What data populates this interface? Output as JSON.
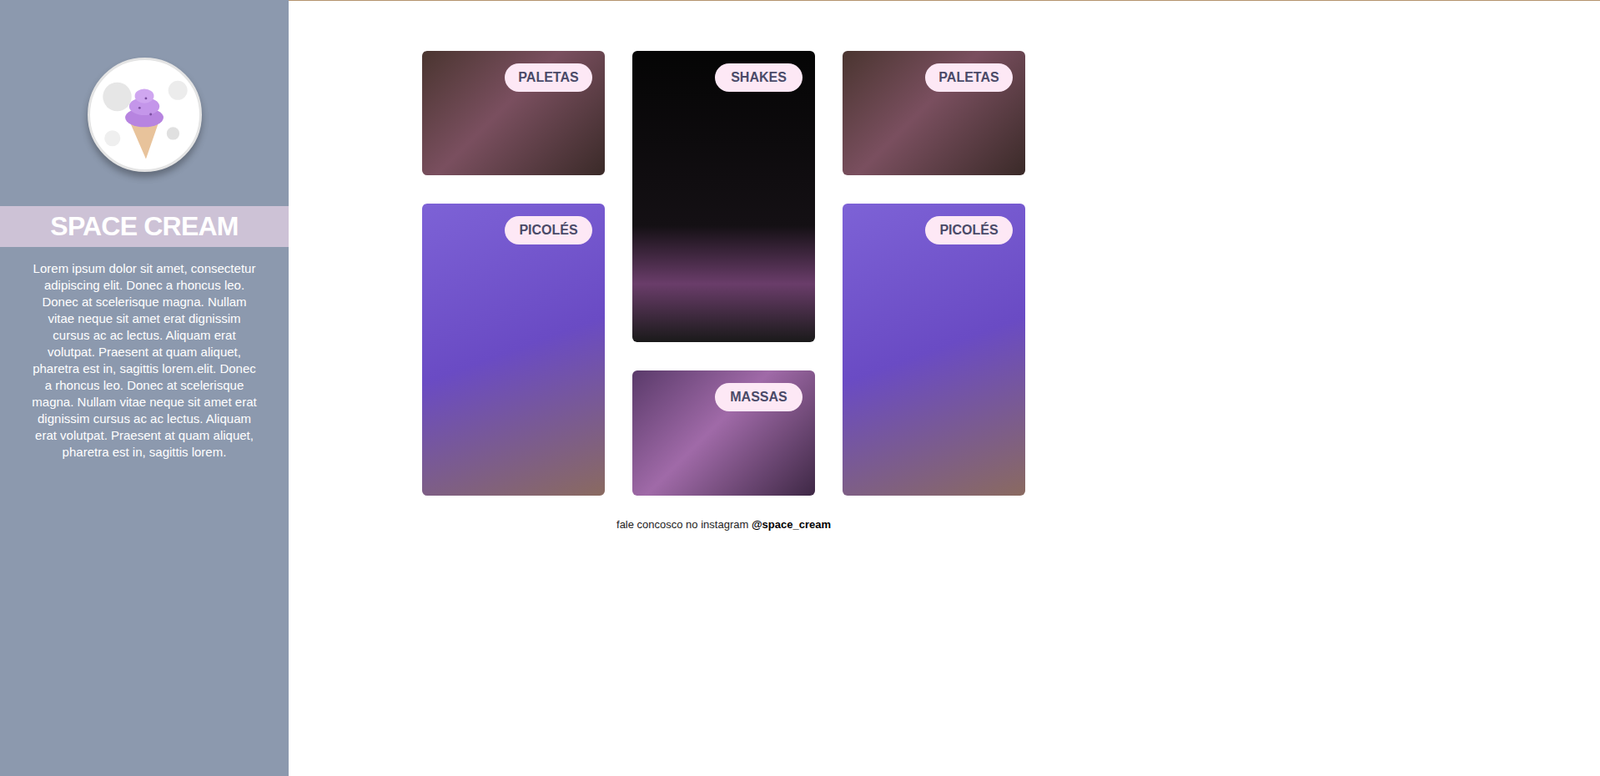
{
  "sidebar": {
    "title": "SPACE CREAM",
    "description": "Lorem ipsum dolor sit amet, consectetur adipiscing elit. Donec a rhoncus leo. Donec at scelerisque magna. Nullam vitae neque sit amet erat dignissim cursus ac ac lectus. Aliquam erat volutpat. Praesent at quam aliquet, pharetra est in, sagittis lorem.elit. Donec a rhoncus leo. Donec at scelerisque magna. Nullam vitae neque sit amet erat dignissim cursus ac ac lectus. Aliquam erat volutpat. Praesent at quam aliquet, pharetra est in, sagittis lorem."
  },
  "gallery": {
    "columns": [
      [
        {
          "label": "PALETAS"
        },
        {
          "label": "PICOLÉS"
        }
      ],
      [
        {
          "label": "SHAKES"
        },
        {
          "label": "MASSAS"
        }
      ],
      [
        {
          "label": "PALETAS"
        },
        {
          "label": "PICOLÉS"
        }
      ]
    ]
  },
  "footer": {
    "text": "fale concosco no instagram",
    "handle": "@space_cream"
  }
}
